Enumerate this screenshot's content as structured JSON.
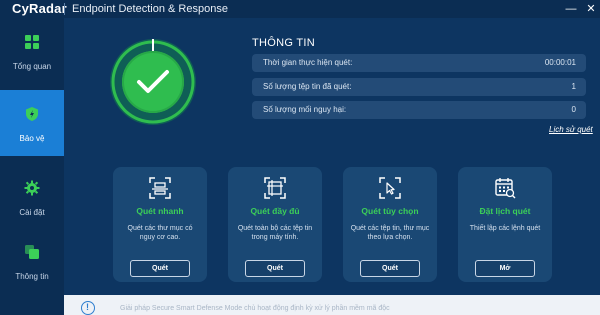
{
  "app": {
    "logo": "CyRadar",
    "title": "Endpoint Detection & Response",
    "minimize": "—",
    "close": "✕"
  },
  "sidebar": {
    "items": [
      {
        "label": "Tổng quan",
        "icon": "dashboard-icon"
      },
      {
        "label": "Bảo vệ",
        "icon": "shield-icon",
        "active": true
      },
      {
        "label": "Cài đặt",
        "icon": "gear-icon"
      },
      {
        "label": "Thông tin",
        "icon": "info-copy-icon"
      }
    ]
  },
  "status": {
    "icon": "checkmark-icon",
    "color": "#2fbd4f"
  },
  "info": {
    "title": "THÔNG TIN",
    "rows": [
      {
        "key": "Thời gian thực hiện quét:",
        "value": "00:00:01"
      },
      {
        "key": "Số lượng tệp tin đã quét:",
        "value": "1"
      },
      {
        "key": "Số lượng mối nguy hại:",
        "value": "0"
      }
    ],
    "history_link": "Lịch sử quét"
  },
  "cards": [
    {
      "icon": "quick-scan-icon",
      "title": "Quét nhanh",
      "desc": "Quét các thư mục có nguy cơ cao.",
      "button": "Quét"
    },
    {
      "icon": "full-scan-icon",
      "title": "Quét đầy đủ",
      "desc": "Quét toàn bộ các tệp tin trong máy tính.",
      "button": "Quét"
    },
    {
      "icon": "custom-scan-icon",
      "title": "Quét tùy chọn",
      "desc": "Quét các tệp tin, thư mục theo lựa chọn.",
      "button": "Quét"
    },
    {
      "icon": "schedule-icon",
      "title": "Đặt lịch quét",
      "desc": "Thiết lập các lệnh quét",
      "button": "Mở"
    }
  ],
  "banner": {
    "icon": "info-icon",
    "text": "Giải pháp Secure Smart Defense Mode chủ hoạt động định kỳ xử lý phần mềm mã độc"
  },
  "colors": {
    "background": "#0d3561",
    "sidebar": "#0b2d53",
    "active": "#1b7fd6",
    "accent_green": "#3ccf58"
  }
}
